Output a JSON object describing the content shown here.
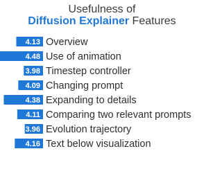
{
  "title": {
    "line1": "Usefulness of",
    "brand": "Diffusion Explainer",
    "suffix": " Features"
  },
  "colors": {
    "bar": "#1f78d8",
    "brand": "#1f78d8"
  },
  "chart_data": {
    "type": "bar",
    "orientation": "horizontal",
    "title": "Usefulness of Diffusion Explainer Features",
    "categories": [
      "Overview",
      "Use of animation",
      "Timestep controller",
      "Changing prompt",
      "Expanding to details",
      "Comparing two relevant prompts",
      "Evolution trajectory",
      "Text below visualization"
    ],
    "values": [
      4.13,
      4.48,
      3.98,
      4.09,
      4.38,
      4.11,
      3.96,
      4.16
    ],
    "value_labels": [
      "4.13",
      "4.48",
      "3.98",
      "4.09",
      "4.38",
      "4.11",
      "3.96",
      "4.16"
    ],
    "grid": false,
    "legend": "none"
  }
}
